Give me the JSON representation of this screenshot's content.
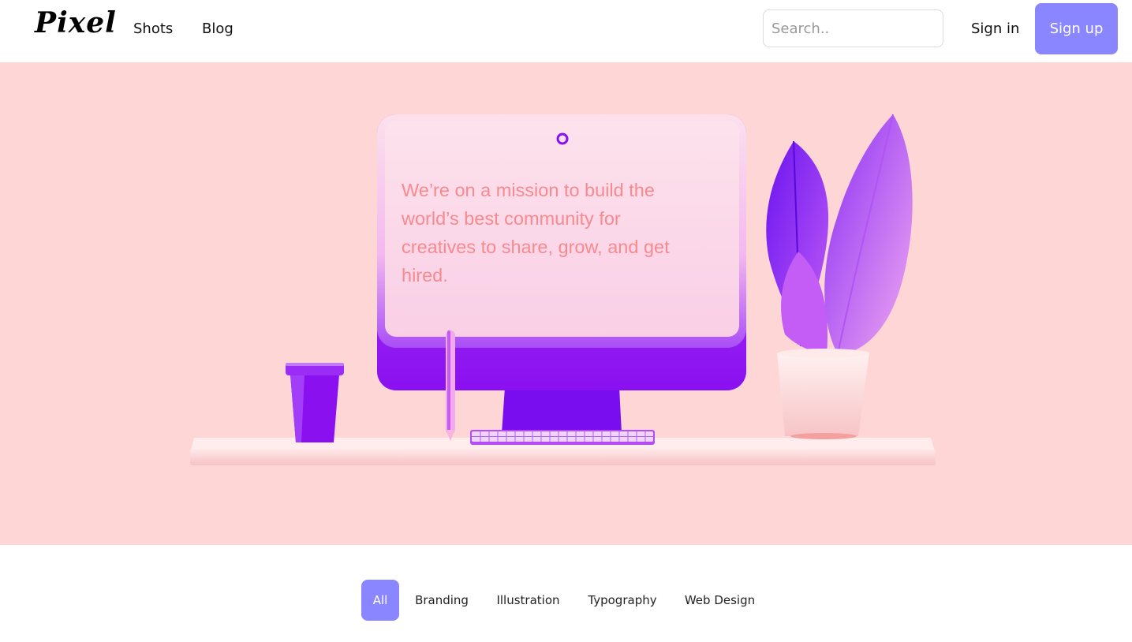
{
  "brand": {
    "logo_text": "Pixel"
  },
  "nav": {
    "links": [
      "Shots",
      "Blog"
    ]
  },
  "search": {
    "placeholder": "Search..",
    "value": ""
  },
  "auth": {
    "signin_label": "Sign in",
    "signup_label": "Sign up"
  },
  "hero": {
    "mission_text": "We’re on a mission to build the world’s best community for creatives to share, grow, and get hired."
  },
  "filters": {
    "chips": [
      "All",
      "Branding",
      "Illustration",
      "Typography",
      "Web Design"
    ],
    "active": "All"
  },
  "colors": {
    "accent": "#8a86ff",
    "hero_bg": "#ffd6d6",
    "mission_text": "#f78a8e",
    "purple": "#8a10f0"
  }
}
